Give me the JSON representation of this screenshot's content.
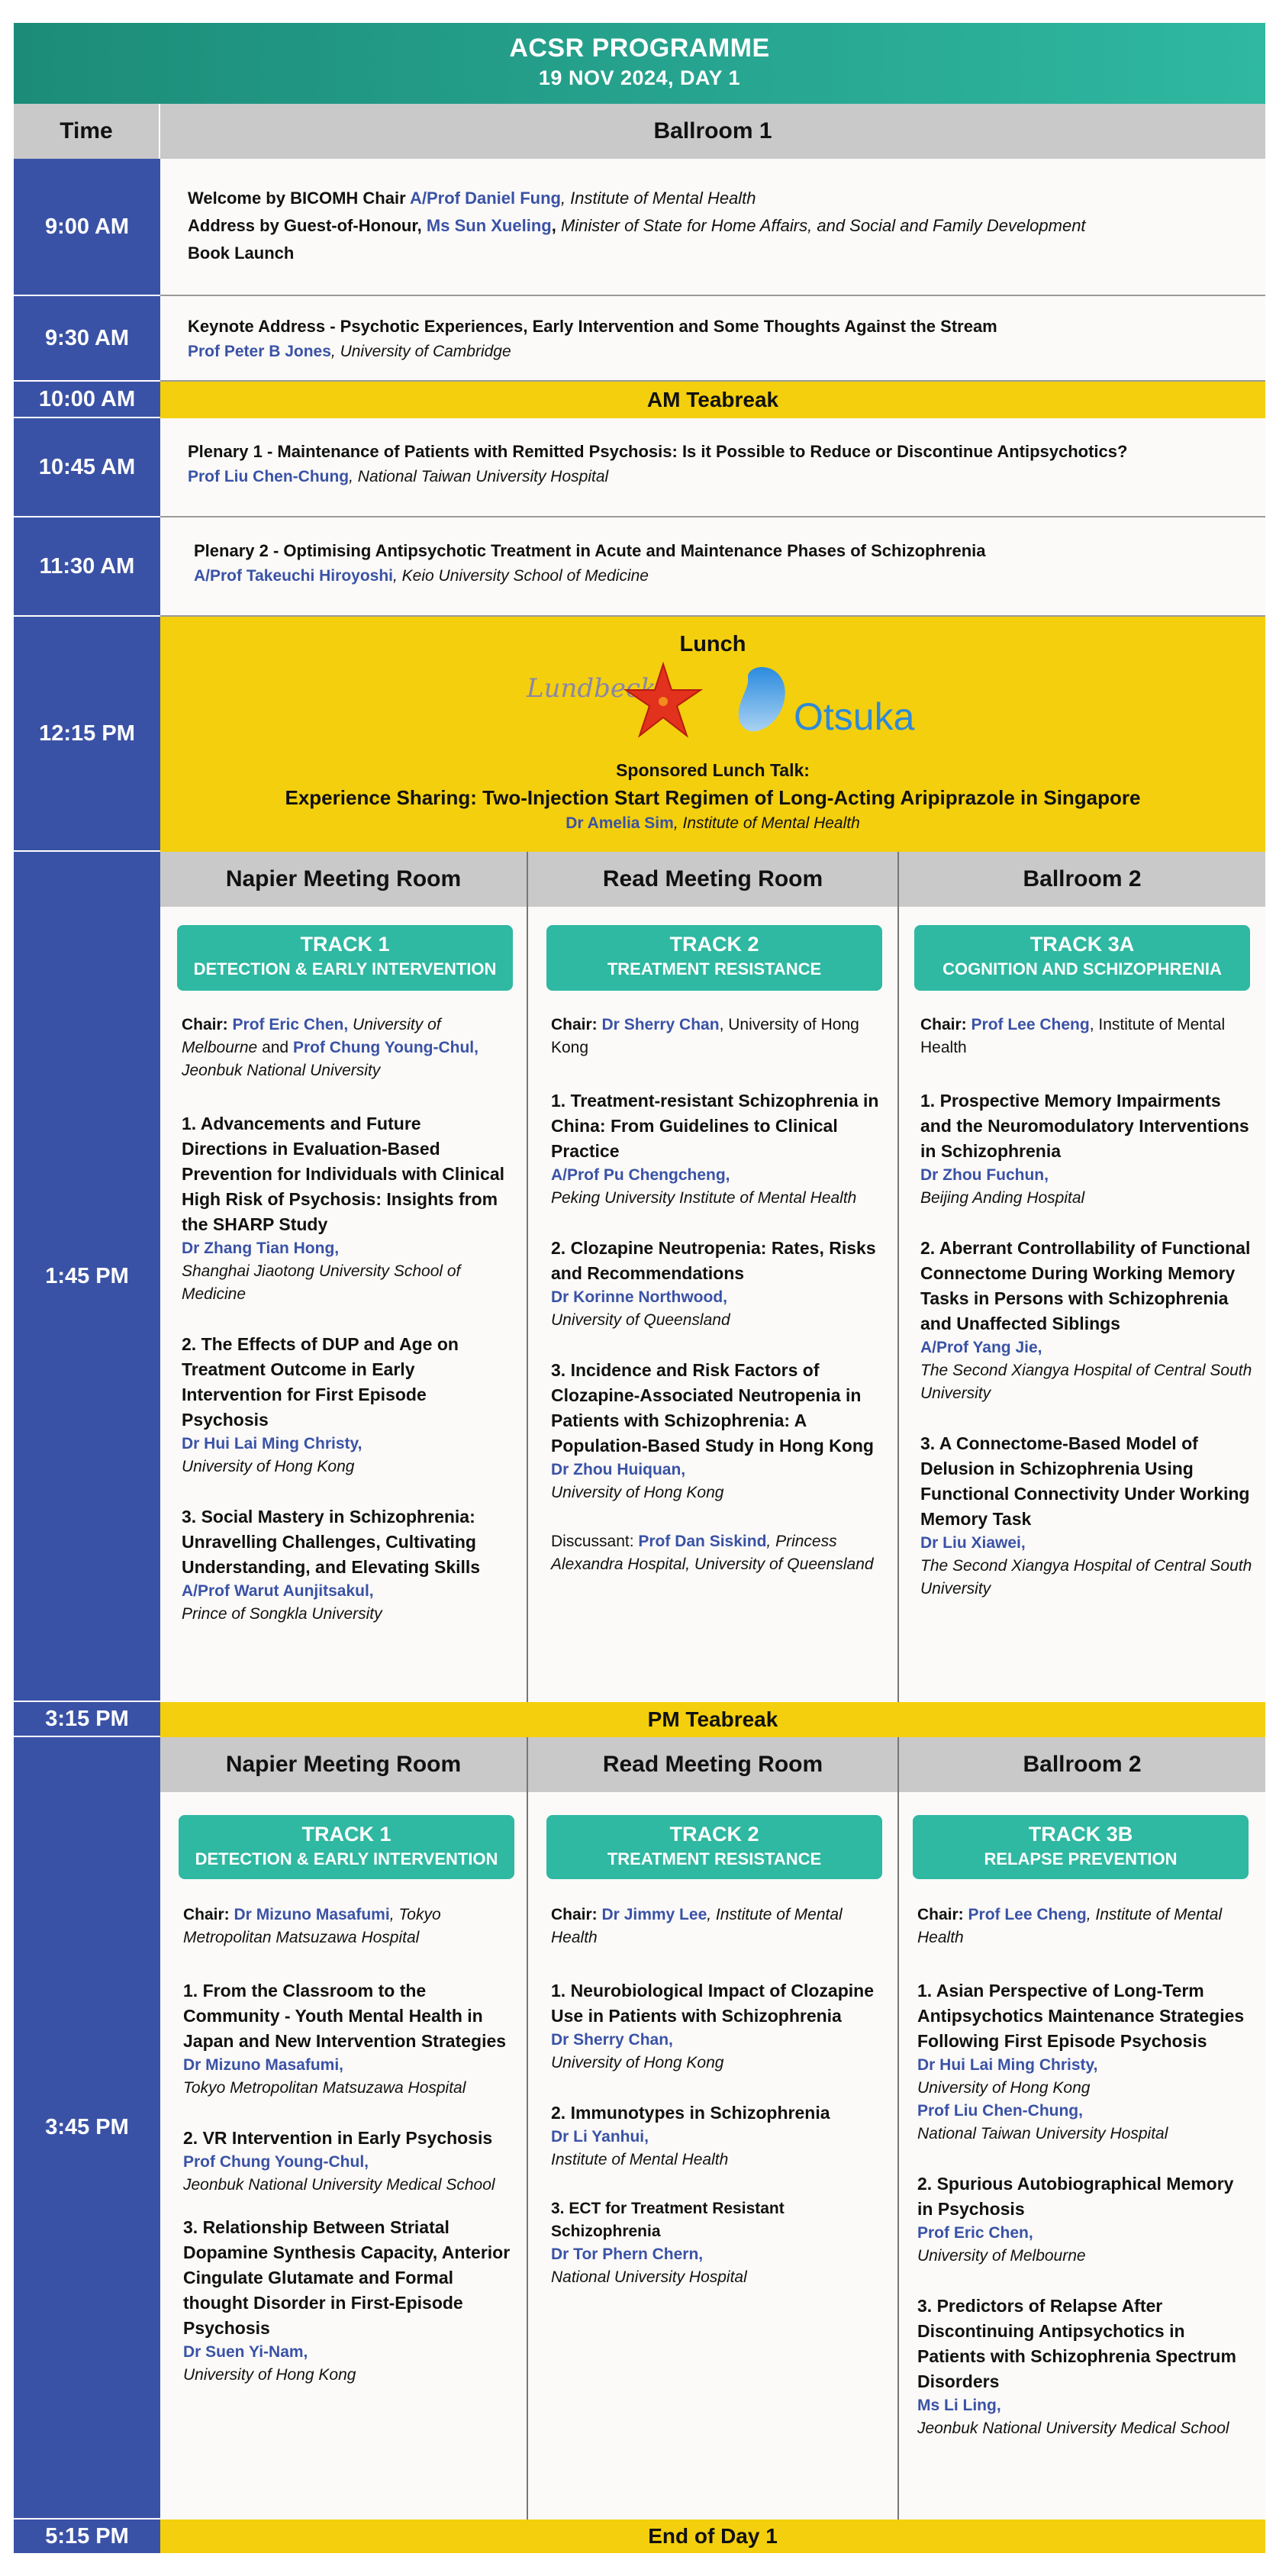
{
  "header": {
    "title": "ACSR PROGRAMME",
    "date": "19 NOV 2024, DAY 1"
  },
  "columns": {
    "time": "Time",
    "main": "Ballroom  1"
  },
  "times": {
    "t0900": "9:00 AM",
    "t0930": "9:30 AM",
    "t1000": "10:00 AM",
    "t1045": "10:45 AM",
    "t1130": "11:30 AM",
    "t1215": "12:15 PM",
    "t1345": "1:45 PM",
    "t1515": "3:15 PM",
    "t1545": "3:45 PM",
    "t1715": "5:15 PM"
  },
  "opening": {
    "l1_pre": "Welcome by BICOMH Chair ",
    "l1_name": "A/Prof Daniel Fung",
    "l1_aff": ", Institute of Mental Health",
    "l2_pre": "Address by Guest-of-Honour, ",
    "l2_name": "Ms Sun Xueling",
    "l2_sep": ", ",
    "l2_aff": "Minister of State for Home Affairs, and Social and Family Development",
    "l3": "Book Launch"
  },
  "keynote": {
    "title": "Keynote Address - Psychotic Experiences, Early Intervention and Some Thoughts Against the Stream",
    "name": "Prof Peter B Jones",
    "aff": ", University of Cambridge"
  },
  "am_teabreak": "AM Teabreak",
  "plenary1": {
    "title": "Plenary 1 - Maintenance of Patients with Remitted Psychosis: Is it Possible to Reduce or Discontinue Antipsychotics?",
    "name": "Prof Liu Chen-Chung",
    "aff": ", National Taiwan University Hospital"
  },
  "plenary2": {
    "title": "Plenary 2 - Optimising Antipsychotic Treatment in Acute and Maintenance Phases of Schizophrenia",
    "name": "A/Prof Takeuchi Hiroyoshi",
    "aff": ", Keio University School of Medicine"
  },
  "lunch": {
    "title": "Lunch",
    "sponsor1": "Lundbeck",
    "sponsor2": "Otsuka",
    "talk_label": "Sponsored Lunch Talk:",
    "talk_title": "Experience Sharing: Two-Injection Start Regimen of Long-Acting Aripiprazole in Singapore",
    "name": "Dr Amelia Sim",
    "aff": ", Institute of Mental Health"
  },
  "afternoon1": {
    "rooms": [
      "Napier Meeting Room",
      "Read Meeting Room",
      "Ballroom 2"
    ],
    "tracks": [
      {
        "track": "TRACK 1",
        "subtitle": "DETECTION & EARLY INTERVENTION",
        "chair_label": "Chair: ",
        "chair1": "Prof Eric Chen,",
        "chair1_aff": " University of Melbourne",
        "chair_and": " and ",
        "chair2": "Prof Chung Young-Chul,",
        "chair2_aff": " Jeonbuk National University",
        "talks": [
          {
            "title": "1. Advancements and Future Directions in Evaluation-Based Prevention for Individuals with Clinical High Risk of Psychosis: Insights from the SHARP Study",
            "name": "Dr Zhang Tian Hong,",
            "aff": "Shanghai Jiaotong University School of Medicine"
          },
          {
            "title": "2. The Effects of DUP and Age on Treatment Outcome in Early Intervention for First Episode Psychosis",
            "name": "Dr Hui Lai Ming Christy,",
            "aff": "University of Hong Kong"
          },
          {
            "title": "3. Social Mastery in Schizophrenia: Unravelling Challenges, Cultivating Understanding, and Elevating Skills",
            "name": "A/Prof Warut Aunjitsakul,",
            "aff": "Prince of Songkla University"
          }
        ]
      },
      {
        "track": "TRACK 2",
        "subtitle": "TREATMENT RESISTANCE",
        "chair_label": "Chair: ",
        "chair1": "Dr Sherry Chan",
        "chair1_aff": ", University of Hong Kong",
        "talks": [
          {
            "title": "1. Treatment-resistant Schizophrenia in China: From Guidelines to Clinical Practice",
            "name": "A/Prof Pu Chengcheng,",
            "aff": "Peking University Institute of Mental Health"
          },
          {
            "title": "2. Clozapine Neutropenia: Rates, Risks and Recommendations",
            "name": "Dr Korinne Northwood,",
            "aff": "University of Queensland"
          },
          {
            "title": "3. Incidence and Risk Factors of Clozapine-Associated Neutropenia in Patients with Schizophrenia: A Population-Based Study in Hong Kong",
            "name": "Dr Zhou Huiquan,",
            "aff": "University of Hong Kong"
          }
        ],
        "discussant_label": "Discussant: ",
        "discussant": "Prof Dan Siskind",
        "discussant_aff": ", Princess Alexandra Hospital, University of Queensland"
      },
      {
        "track": "TRACK 3A",
        "subtitle": "COGNITION AND SCHIZOPHRENIA",
        "chair_label": "Chair: ",
        "chair1": "Prof Lee Cheng",
        "chair1_aff": ", Institute of Mental Health",
        "talks": [
          {
            "title": "1. Prospective Memory Impairments and the Neuromodulatory Interventions in Schizophrenia",
            "name": "Dr Zhou Fuchun,",
            "aff": "Beijing Anding Hospital"
          },
          {
            "title": "2. Aberrant Controllability of Functional Connectome During Working Memory Tasks in Persons with Schizophrenia and Unaffected Siblings",
            "name": "A/Prof Yang Jie,",
            "aff": "The Second Xiangya Hospital of Central South University"
          },
          {
            "title": "3. A Connectome-Based Model of Delusion in Schizophrenia Using Functional Connectivity Under Working Memory Task",
            "name": "Dr Liu Xiawei,",
            "aff": "The Second Xiangya Hospital of Central South University"
          }
        ]
      }
    ]
  },
  "pm_teabreak": "PM Teabreak",
  "afternoon2": {
    "rooms": [
      "Napier Meeting Room",
      "Read Meeting Room",
      "Ballroom 2"
    ],
    "tracks": [
      {
        "track": "TRACK 1",
        "subtitle": "DETECTION & EARLY INTERVENTION",
        "chair_label": "Chair: ",
        "chair1": "Dr Mizuno Masafumi",
        "chair1_aff": ", Tokyo Metropolitan Matsuzawa Hospital",
        "talks": [
          {
            "title": "1. From the Classroom to the Community - Youth Mental Health in Japan and New Intervention Strategies",
            "name": "Dr Mizuno Masafumi,",
            "aff": "Tokyo Metropolitan Matsuzawa Hospital"
          },
          {
            "title": "2. VR Intervention in Early Psychosis",
            "name": "Prof Chung Young-Chul,",
            "aff": "Jeonbuk National University Medical School"
          },
          {
            "title": "3. Relationship Between Striatal Dopamine Synthesis Capacity, Anterior Cingulate Glutamate and Formal thought Disorder in First-Episode Psychosis",
            "name": "Dr Suen Yi-Nam,",
            "aff": "University of Hong Kong"
          }
        ]
      },
      {
        "track": "TRACK 2",
        "subtitle": "TREATMENT RESISTANCE",
        "chair_label": "Chair: ",
        "chair1": "Dr Jimmy Lee",
        "chair1_aff": ", Institute of Mental Health",
        "talks": [
          {
            "title": "1. Neurobiological Impact of Clozapine Use in Patients with Schizophrenia",
            "name": "Dr Sherry Chan,",
            "aff": "University of Hong Kong"
          },
          {
            "title": "2. Immunotypes in Schizophrenia",
            "name": "Dr Li Yanhui,",
            "aff": "Institute of Mental Health"
          },
          {
            "title": "3. ECT for Treatment Resistant Schizophrenia",
            "name": "Dr Tor Phern Chern,",
            "aff": "National University Hospital"
          }
        ]
      },
      {
        "track": "TRACK 3B",
        "subtitle": "RELAPSE PREVENTION",
        "chair_label": "Chair: ",
        "chair1": "Prof Lee Cheng",
        "chair1_aff": ", Institute of Mental Health",
        "talks": [
          {
            "title": "1. Asian Perspective of Long-Term Antipsychotics Maintenance Strategies Following First Episode Psychosis",
            "name": "Dr Hui Lai Ming Christy,",
            "aff": "University of Hong Kong",
            "name2": "Prof Liu Chen-Chung,",
            "aff2": "National Taiwan University Hospital"
          },
          {
            "title": "2. Spurious Autobiographical Memory in Psychosis",
            "name": "Prof Eric Chen,",
            "aff": "University of Melbourne"
          },
          {
            "title": "3. Predictors of Relapse After Discontinuing Antipsychotics in Patients with Schizophrenia Spectrum Disorders",
            "name": "Ms Li Ling,",
            "aff": "Jeonbuk National University Medical School"
          }
        ]
      }
    ]
  },
  "end": "End of Day 1",
  "colors": {
    "header": "#1c8c78",
    "time": "#3a52a6",
    "highlight": "#f4cf0d",
    "track": "#2fb8a2",
    "name": "#3a52a6"
  }
}
